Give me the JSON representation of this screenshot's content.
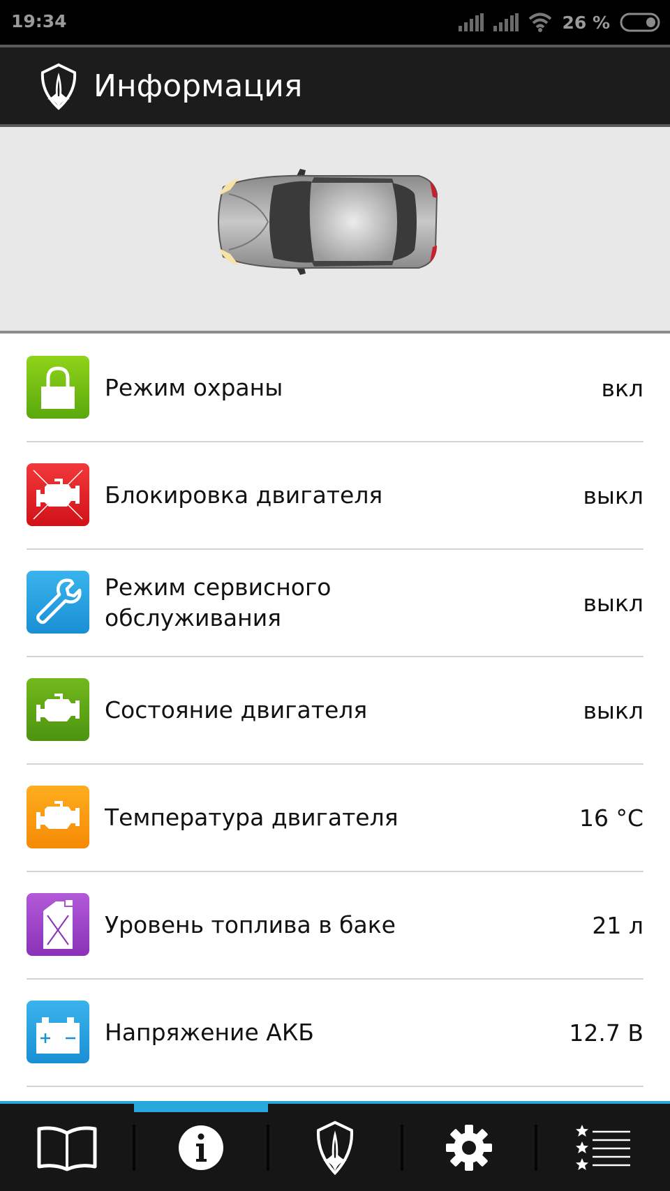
{
  "status_bar": {
    "time": "19:34",
    "battery_percent": "26 %",
    "icons": [
      "signal-icon",
      "signal-icon",
      "wifi-icon",
      "battery-icon"
    ]
  },
  "app_bar": {
    "title": "Информация",
    "logo_icon": "alarm-logo-icon"
  },
  "car": {
    "icon": "car-top-view",
    "color": "#b8b8b8"
  },
  "items": [
    {
      "label": "Режим охраны",
      "value": "вкл",
      "icon": "lock-icon",
      "color_top": "#8fd41a",
      "color_bottom": "#5aa80c"
    },
    {
      "label": "Блокировка двигателя",
      "value": "выкл",
      "icon": "engine-blocked-icon",
      "color_top": "#f2383a",
      "color_bottom": "#d01218"
    },
    {
      "label": "Режим сервисного обслуживания",
      "value": "выкл",
      "icon": "wrench-icon",
      "color_top": "#3ab4ec",
      "color_bottom": "#1a8fd4"
    },
    {
      "label": "Состояние двигателя",
      "value": "выкл",
      "icon": "engine-icon",
      "color_top": "#72b81c",
      "color_bottom": "#4c9410"
    },
    {
      "label": "Температура двигателя",
      "value": "16 °C",
      "icon": "engine-icon",
      "color_top": "#ffad1f",
      "color_bottom": "#f58a06"
    },
    {
      "label": "Уровень топлива в баке",
      "value": "21 л",
      "icon": "fuel-canister-icon",
      "color_top": "#b25ad8",
      "color_bottom": "#8a32b8"
    },
    {
      "label": "Напряжение АКБ",
      "value": "12.7 В",
      "icon": "battery-car-icon",
      "color_top": "#3ab4ec",
      "color_bottom": "#1a8fd4"
    }
  ],
  "nav": {
    "active_index": 1,
    "accent_color": "#29a8dc",
    "items": [
      "book-icon",
      "info-icon",
      "alarm-logo-icon",
      "gear-icon",
      "rated-list-icon"
    ]
  }
}
